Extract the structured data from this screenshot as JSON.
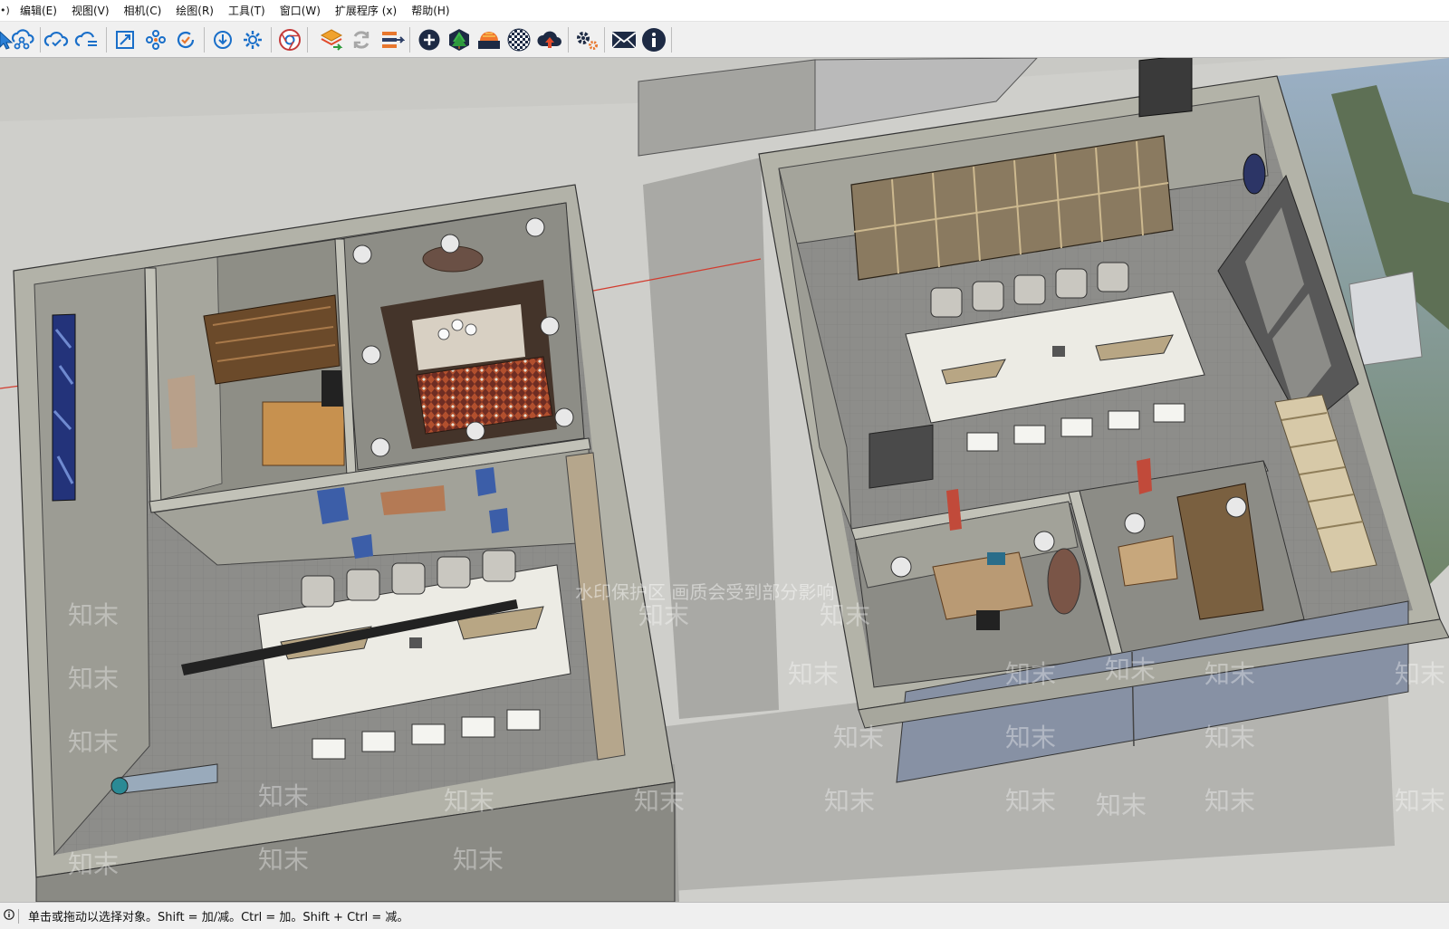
{
  "menubar": {
    "lead": "•)",
    "items": [
      "编辑(E)",
      "视图(V)",
      "相机(C)",
      "绘图(R)",
      "工具(T)",
      "窗口(W)",
      "扩展程序 (x)",
      "帮助(H)"
    ]
  },
  "toolbar": {
    "icons": [
      "select-icon",
      "cloud-network-icon",
      "cloud-sync-icon",
      "cloud-list-icon",
      "zoom-extents-icon",
      "components-icon",
      "check-refresh-icon",
      "download-icon",
      "settings-icon",
      "chrome-icon",
      "layer-arrow-icon",
      "refresh-icon",
      "stack-arrow-icon",
      "plus-circle-icon",
      "tree-hex-icon",
      "sunset-icon",
      "checker-sphere-icon",
      "cloud-upload-icon",
      "gears-icon",
      "mail-icon",
      "info-icon"
    ]
  },
  "viewport": {
    "watermark_text": "知末",
    "watermark_notice": "水印保护区  画质会受到部分影响"
  },
  "statusbar": {
    "info_icon": "info-icon",
    "message": "单击或拖动以选择对象。Shift = 加/减。Ctrl = 加。Shift + Ctrl = 减。"
  }
}
